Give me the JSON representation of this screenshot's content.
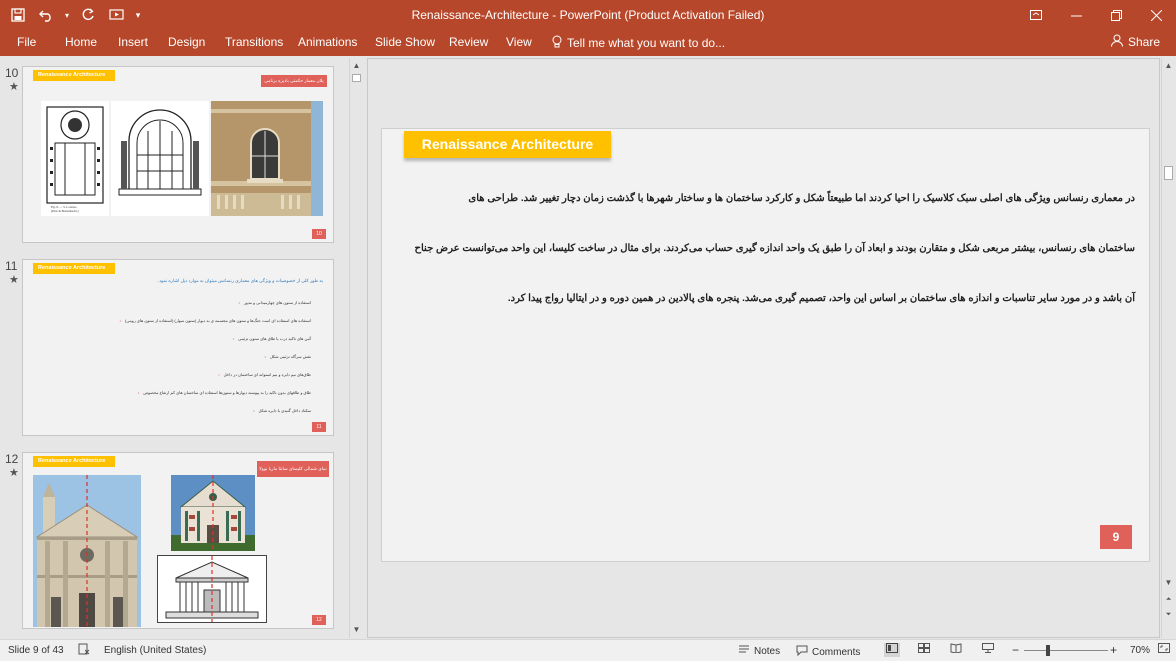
{
  "window": {
    "title": "Renaissance-Architecture - PowerPoint (Product Activation Failed)",
    "accent": "#b7472a"
  },
  "ribbon": {
    "tabs": [
      "File",
      "Home",
      "Insert",
      "Design",
      "Transitions",
      "Animations",
      "Slide Show",
      "Review",
      "View"
    ],
    "tell_me": "Tell me what you want to do...",
    "share": "Share"
  },
  "thumbnails": [
    {
      "number": "10",
      "tag": "Renaissance Architecture",
      "red_label": "پلان معمار حکمتی بادیزه برنامی",
      "page": "10",
      "caption": "Fig. 8. — S. Lorenzo.\n(Plan de Brunelleschi.)"
    },
    {
      "number": "11",
      "tag": "Renaissance Architecture",
      "intro": "به طور کلی از خصوصیات و ویژگی های معماری رنسانس میتوان به موارد ذیل اشاره نمود .",
      "bullets": [
        "استفاده از ستون های چهارمیدانی و مدور",
        "استفاده های استفاده ای است جنگ‌ها و ستون های مجسمه ی به دیوار (ستون سوار) (استفاده از ستون های رومی)",
        "آئین های تاکید درب یا طاق های ستون تزئینی",
        "نقش سرگاه تزئینی شکل",
        "طاق‌های نیم دایره و نیم استوانه ای ساختمان در داخل",
        "طاق و طاقهای بدون تاکید را به پیوسته دیوارها و ستون‌ها استفاده ای ساختمان های کم ارتفاع مخصوص",
        "سکناد داخل گنبدی با دایره شکل"
      ],
      "page": "11"
    },
    {
      "number": "12",
      "tag": "Renaissance Architecture",
      "red_label": "نمای شمالی کلیسای سانتا ماریا نوولا",
      "page": "12"
    }
  ],
  "slide": {
    "tag": "Renaissance Architecture",
    "lines": [
      "در معماری رنسانس ویژگی های اصلی سبک کلاسیک را احیا کردند اما طبیعتاً شکل و کارکرد ساختمان ها و ساختار شهرها با گذشت زمان دچار تغییر شد. طراحی های",
      "ساختمان های رنسانس، بیشتر مربعی شکل و متقارن بودند و ابعاد آن را طبق یک واحد اندازه گیری حساب می‌کردند. برای مثال در ساخت کلیسا، این واحد می‌توانست عرض جناح",
      "آن باشد و در مورد سایر تناسبات و اندازه های ساختمان بر اساس این واحد، تصمیم گیری می‌شد. پنجره های پالادین در همین دوره و در ایتالیا رواج پیدا کرد."
    ],
    "page_number": "9",
    "tag_color": "#ffc000",
    "number_color": "#e0605a"
  },
  "status": {
    "slide_info": "Slide 9 of 43",
    "language": "English (United States)",
    "notes": "Notes",
    "comments": "Comments",
    "zoom": "70%",
    "zoom_minus": "−",
    "zoom_plus": "+"
  }
}
